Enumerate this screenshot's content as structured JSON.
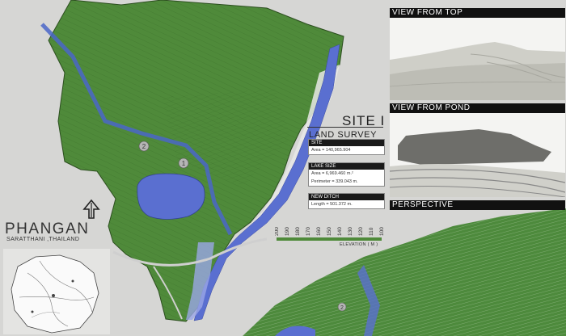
{
  "views": {
    "top": "VIEW FROM TOP",
    "pond": "VIEW FROM POND",
    "perspective": "PERSPECTIVE"
  },
  "site": {
    "title": "SITE I",
    "subtitle": "LAND SURVEY"
  },
  "info": {
    "site_head": "SITE",
    "site_area": "Area = 140,965.904",
    "lake_head": "LAKE SIZE",
    "lake_area": "Area = 6,969.460   m.²",
    "lake_perimeter": "Perimeter = 339.043 m.",
    "ditch_head": "NEW DITCH",
    "ditch_length": "Length = 501.372 m."
  },
  "elevation": {
    "label": "ELEVATION ( M )",
    "ticks": [
      "200",
      "190",
      "180",
      "170",
      "160",
      "150",
      "140",
      "130",
      "120",
      "110",
      "100"
    ]
  },
  "location": {
    "name": "PHANGAN",
    "region": "SARATTHANI ,THAILAND"
  },
  "map_markers": [
    "1",
    "2"
  ],
  "colors": {
    "terrain_green": "#4f8a3a",
    "water_blue": "#5a6fd0",
    "background": "#d6d6d4"
  }
}
